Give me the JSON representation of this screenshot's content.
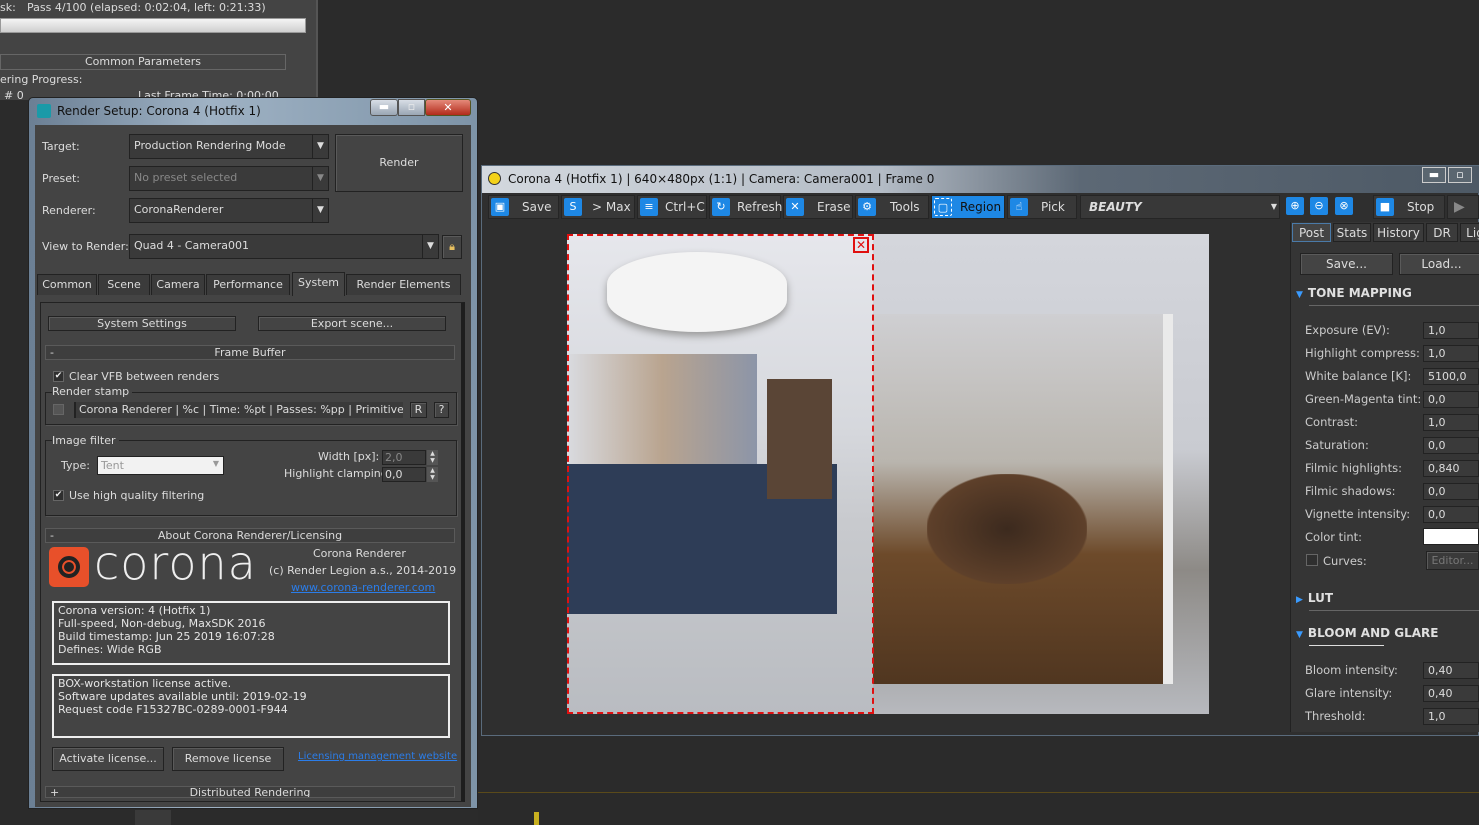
{
  "background_dialog": {
    "task_label": "sk:",
    "task_value": "Pass 4/100 (elapsed: 0:02:04, left: 0:21:33)",
    "progress_fraction": 0.04,
    "common_parameters": "Common Parameters",
    "rendering_progress": "ering Progress:",
    "frame_hash": "#  0",
    "last_frame_time": "Last Frame Time:  0:00:00"
  },
  "render_setup": {
    "title": "Render Setup: Corona 4 (Hotfix 1)",
    "target_label": "Target:",
    "target_value": "Production Rendering Mode",
    "preset_label": "Preset:",
    "preset_value": "No preset selected",
    "renderer_label": "Renderer:",
    "renderer_value": "CoronaRenderer",
    "view_label": "View to Render:",
    "view_value": "Quad 4 - Camera001",
    "render_button": "Render",
    "tabs": [
      "Common",
      "Scene",
      "Camera",
      "Performance",
      "System",
      "Render Elements"
    ],
    "active_tab": "System",
    "system_settings": "System Settings",
    "export_scene": "Export scene...",
    "frame_buffer": {
      "header": "Frame Buffer",
      "collapse": "-",
      "clear_vfb": "Clear VFB between renders",
      "clear_vfb_checked": true,
      "render_stamp": "Render stamp",
      "stamp_checked": false,
      "stamp_value": "Corona Renderer | %c | Time: %pt | Passes: %pp | Primitives: %si",
      "r_button": "R",
      "help_button": "?",
      "image_filter": "Image filter",
      "type_label": "Type:",
      "type_value": "Tent",
      "width_label": "Width [px]:",
      "width_value": "2,0",
      "clamp_label": "Highlight clamping:",
      "clamp_value": "0,0",
      "hq_filter": "Use high quality filtering",
      "hq_checked": true
    },
    "about": {
      "header": "About Corona Renderer/Licensing",
      "collapse": "-",
      "logo_text": "corona",
      "product": "Corona Renderer",
      "copyright": "(c) Render Legion a.s., 2014-2019",
      "website": "www.corona-renderer.com",
      "version_lines": [
        "Corona version: 4 (Hotfix 1)",
        "Full-speed, Non-debug, MaxSDK 2016",
        "Build timestamp: Jun 25 2019 16:07:28",
        "Defines: Wide RGB"
      ],
      "license_lines": [
        "BOX-workstation license active.",
        "Software updates available until: 2019-02-19",
        "Request code F15327BC-0289-0001-F944"
      ],
      "activate": "Activate license...",
      "remove": "Remove license",
      "manage_link": "Licensing management website"
    },
    "distributed": {
      "header": "Distributed Rendering",
      "expand": "+"
    }
  },
  "vfb": {
    "title": "Corona 4 (Hotfix 1) | 640×480px (1:1) | Camera: Camera001 | Frame 0",
    "toolbar": [
      {
        "icon": "save-icon",
        "label": "Save"
      },
      {
        "icon": "max-icon",
        "label": "> Max"
      },
      {
        "icon": "copy-icon",
        "label": "Ctrl+C"
      },
      {
        "icon": "refresh-icon",
        "label": "Refresh"
      },
      {
        "icon": "erase-icon",
        "label": "Erase"
      },
      {
        "icon": "gear-icon",
        "label": "Tools"
      },
      {
        "icon": "region-icon",
        "label": "Region"
      },
      {
        "icon": "pick-icon",
        "label": "Pick"
      }
    ],
    "channel": "BEAUTY",
    "stop": "Stop",
    "accent": "#1e88e5",
    "region_color": "#e01010",
    "panel": {
      "tabs": [
        "Post",
        "Stats",
        "History",
        "DR",
        "Lig"
      ],
      "active_tab": "Post",
      "save": "Save...",
      "load": "Load...",
      "tone_mapping": "TONE MAPPING",
      "params": [
        {
          "label": "Exposure (EV):",
          "value": "1,0"
        },
        {
          "label": "Highlight compress:",
          "value": "1,0"
        },
        {
          "label": "White balance [K]:",
          "value": "5100,0"
        },
        {
          "label": "Green-Magenta tint:",
          "value": "0,0"
        },
        {
          "label": "Contrast:",
          "value": "1,0"
        },
        {
          "label": "Saturation:",
          "value": "0,0"
        },
        {
          "label": "Filmic highlights:",
          "value": "0,840"
        },
        {
          "label": "Filmic shadows:",
          "value": "0,0"
        },
        {
          "label": "Vignette intensity:",
          "value": "0,0"
        }
      ],
      "color_tint": "Color tint:",
      "color_tint_value": "#ffffff",
      "curves": "Curves:",
      "editor": "Editor...",
      "lut": "LUT",
      "bloom_glare": "BLOOM AND GLARE",
      "bloom_params": [
        {
          "label": "Bloom intensity:",
          "value": "0,40"
        },
        {
          "label": "Glare intensity:",
          "value": "0,40"
        },
        {
          "label": "Threshold:",
          "value": "1,0"
        }
      ]
    }
  }
}
